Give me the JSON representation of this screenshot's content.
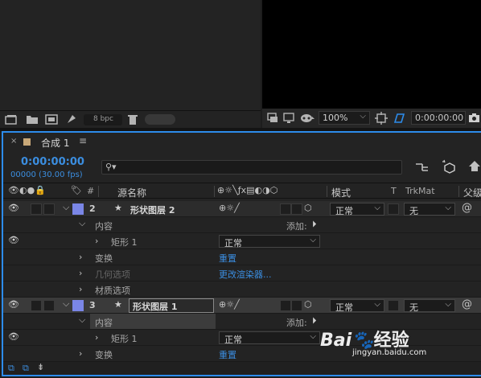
{
  "project": {
    "bpc": "8 bpc"
  },
  "viewer": {
    "zoom": "100%",
    "timecode": "0:00:00:00"
  },
  "timeline": {
    "tab": "合成 1",
    "timecode": "0:00:00:00",
    "fps": "00000 (30.00 fps)",
    "search_placeholder": "",
    "columns": {
      "num": "#",
      "source": "源名称",
      "mode": "模式",
      "t": "T",
      "trkmat": "TrkMat",
      "parent": "父级"
    },
    "rows": {
      "layer2": {
        "num": "2",
        "name": "形状图层 2",
        "mode": "正常",
        "trkmat": "无"
      },
      "contents": "内容",
      "add": "添加:",
      "rect": "矩形 1",
      "rect_mode": "正常",
      "transform": "变换",
      "reset": "重置",
      "geometry": "几何选项",
      "change_renderer": "更改渲染器...",
      "material": "材质选项",
      "layer1": {
        "num": "3",
        "name": "形状图层 1",
        "mode": "正常",
        "trkmat": "无"
      },
      "contents2": "内容",
      "add2": "添加:",
      "rect2": "矩形 1",
      "rect2_mode": "正常",
      "transform2": "变换",
      "reset2": "重置"
    }
  },
  "watermark": {
    "brand_a": "Bai",
    "brand_b": "经验",
    "url": "jingyan.baidu.com"
  }
}
